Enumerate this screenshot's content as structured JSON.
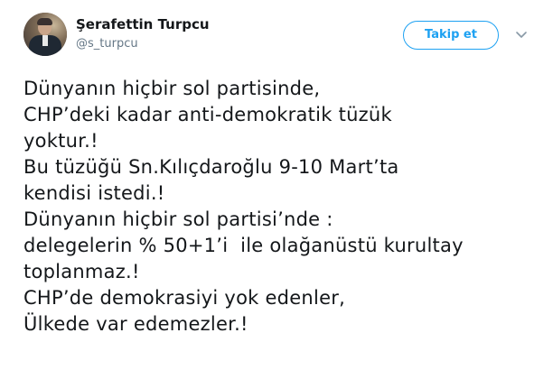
{
  "author": {
    "name": "Şerafettin Turpcu",
    "handle": "@s_turpcu",
    "avatar_icon": "profile-photo"
  },
  "actions": {
    "follow_label": "Takip et",
    "more_icon": "chevron-down-icon"
  },
  "colors": {
    "accent": "#1da1f2",
    "text": "#14171a",
    "muted": "#657786"
  },
  "tweet": {
    "lines": [
      "Dünyanın hiçbir sol partisinde,",
      "CHP’deki kadar anti-demokratik tüzük",
      "yoktur.!",
      "Bu tüzüğü Sn.Kılıçdaroğlu 9-10 Mart’ta",
      "kendisi istedi.!",
      "Dünyanın hiçbir sol partisi’nde :",
      "delegelerin % 50+1’i  ile olağanüstü kurultay",
      "toplanmaz.!",
      "CHP’de demokrasiyi yok edenler,",
      "Ülkede var edemezler.!"
    ]
  }
}
